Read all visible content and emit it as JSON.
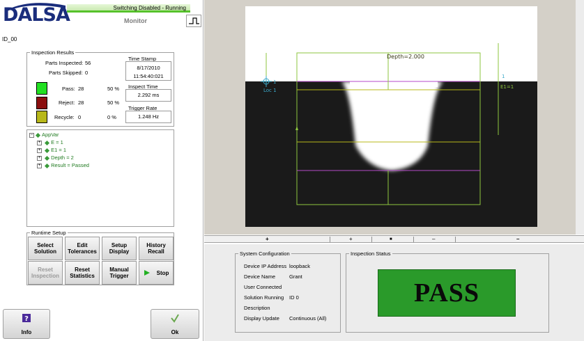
{
  "app": {
    "logo": "DALSA",
    "status_bar": "Switching Disabled - Running",
    "mode": "Monitor",
    "device_id": "ID_00"
  },
  "inspection_results": {
    "title": "Inspection Results",
    "parts_inspected_label": "Parts Inspected:",
    "parts_inspected": "56",
    "parts_skipped_label": "Parts Skipped:",
    "parts_skipped": "0",
    "pass_label": "Pass:",
    "pass_count": "28",
    "pass_pct": "50 %",
    "reject_label": "Reject:",
    "reject_count": "28",
    "reject_pct": "50 %",
    "recycle_label": "Recycle:",
    "recycle_count": "0",
    "recycle_pct": "0 %",
    "timestamp_title": "Time Stamp",
    "timestamp_date": "8/17/2010",
    "timestamp_time": "11:54:40:021",
    "inspect_time_title": "Inspect Time",
    "inspect_time": "2.292 ms",
    "trigger_rate_title": "Trigger Rate",
    "trigger_rate": "1.248 Hz",
    "colors": {
      "pass": "#22e022",
      "reject": "#8b0f0f",
      "recycle": "#b8b81a"
    }
  },
  "tree": {
    "root": "AppVar",
    "items": [
      "E = 1",
      "E1 = 1",
      "Depth = 2",
      "Result = Passed"
    ]
  },
  "runtime": {
    "title": "Runtime Setup",
    "buttons": [
      {
        "label1": "Select",
        "label2": "Solution"
      },
      {
        "label1": "Edit",
        "label2": "Tolerances"
      },
      {
        "label1": "Setup",
        "label2": "Display"
      },
      {
        "label1": "History",
        "label2": "Recall"
      },
      {
        "label1": "Reset",
        "label2": "Inspection"
      },
      {
        "label1": "Reset",
        "label2": "Statistics"
      },
      {
        "label1": "Manual",
        "label2": "Trigger"
      },
      {
        "label1": "Stop",
        "label2": ""
      }
    ]
  },
  "footer": {
    "info_label": "Info",
    "ok_label": "Ok"
  },
  "overlay": {
    "depth": "Depth=2.000",
    "loc": "Loc 1",
    "loc_tick": "1",
    "e1_tick": "1",
    "e1": "E1=1"
  },
  "zoom": {
    "zoom_in": "+",
    "zoom_in_small": "+",
    "stop": "■",
    "zoom_out_small": "–",
    "zoom_out": "–"
  },
  "system_config": {
    "title": "System Configuration",
    "rows": [
      {
        "label": "Device IP Address",
        "value": "loopback"
      },
      {
        "label": "Device Name",
        "value": "Grant"
      },
      {
        "label": "User Connected",
        "value": ""
      },
      {
        "label": "Solution Running",
        "value": "ID 0"
      },
      {
        "label": "Description",
        "value": ""
      },
      {
        "label": "Display Update",
        "value": "Continuous (All)"
      }
    ]
  },
  "inspection_status": {
    "title": "Inspection Status",
    "result": "PASS"
  }
}
